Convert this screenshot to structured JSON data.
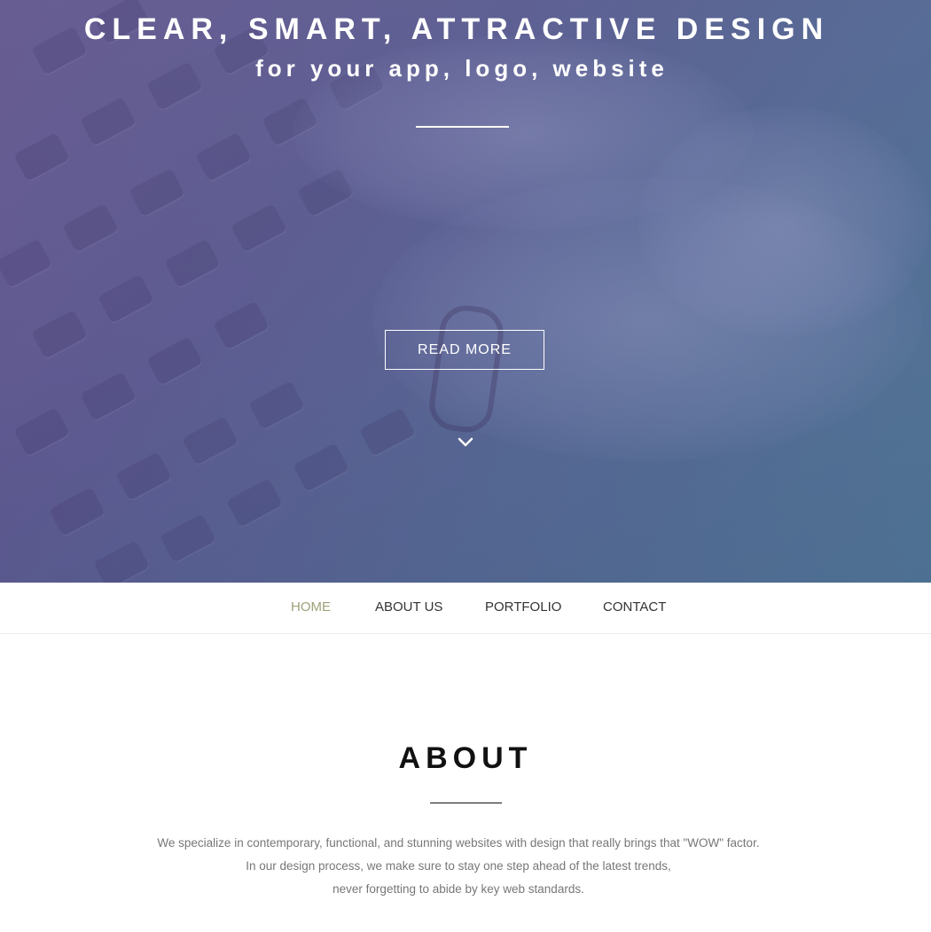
{
  "hero": {
    "title": "CLEAR, SMART, ATTRACTIVE DESIGN",
    "subtitle": "for your app, logo, website",
    "cta_label": "READ MORE",
    "scroll_icon": "chevron-down-icon",
    "overlay_colors": [
      "#6a5a92",
      "#4f7d98"
    ]
  },
  "nav": {
    "items": [
      {
        "label": "HOME",
        "active": true
      },
      {
        "label": "ABOUT US",
        "active": false
      },
      {
        "label": "PORTFOLIO",
        "active": false
      },
      {
        "label": "CONTACT",
        "active": false
      }
    ],
    "active_color": "#a0a07a"
  },
  "about": {
    "title": "ABOUT",
    "lines": [
      "We specialize in contemporary, functional, and stunning websites with design that really brings that \"WOW\" factor.",
      "In our design process, we make sure to stay one step ahead of the latest trends,",
      "never forgetting to abide by key web standards."
    ]
  }
}
